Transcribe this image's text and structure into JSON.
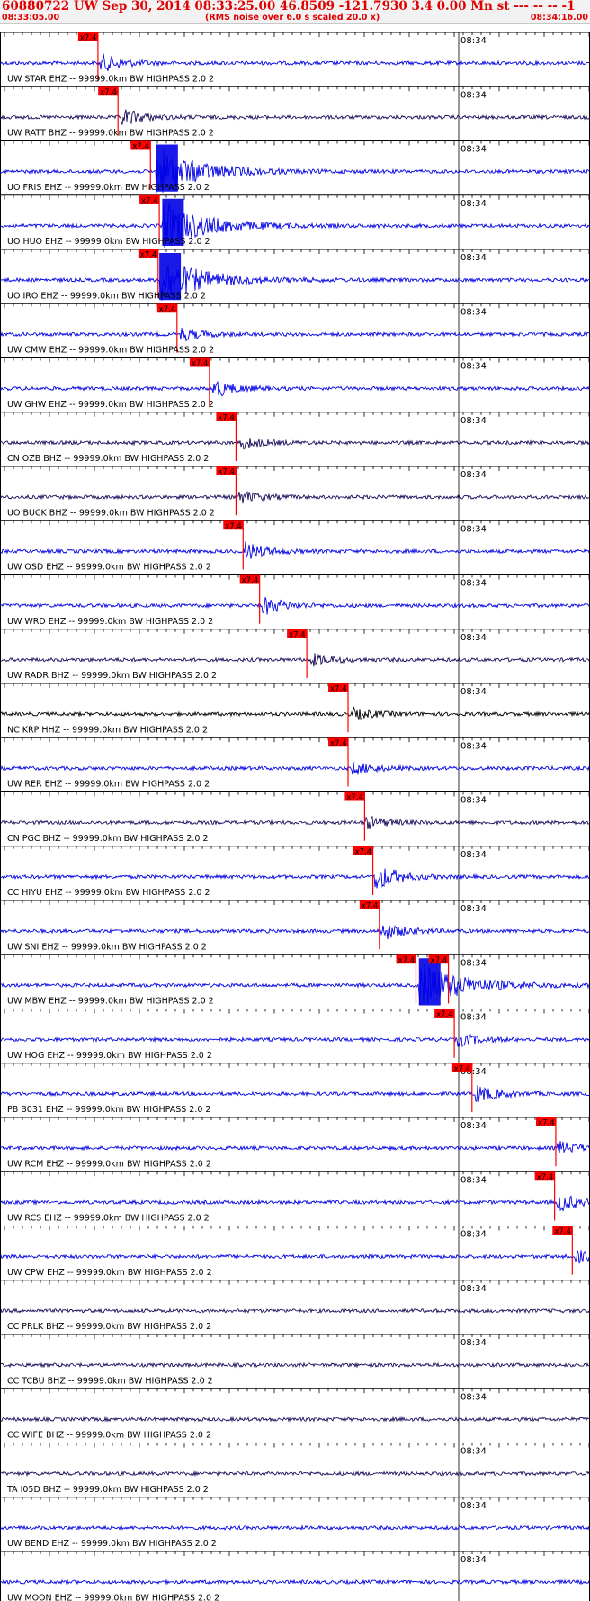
{
  "header": {
    "title": "60880722 UW Sep 30, 2014 08:33:25.00   46.8509 -121.7930  3.4 0.00 Mn st --- -- --   -1",
    "start_time": "08:33:05.00",
    "end_time": "08:34:16.00",
    "rms_note": "(RMS noise over 6.0 s scaled 20.0 x)"
  },
  "colors": {
    "trace_blue": "#0000e6",
    "trace_navy": "#1a0a5a",
    "trace_black": "#000000",
    "pick_red": "#ff0000",
    "axis": "#000000"
  },
  "chart_data": {
    "type": "seismogram",
    "time_start": "08:33:05.00",
    "time_end": "08:34:16.00",
    "minute_mark": "08:34",
    "pick_label": "x7.4",
    "traces": [
      {
        "label": "UW STAR EHZ -- 99999.0km BW  HIGHPASS  2.0  2",
        "color": "blue",
        "pick": 0.166,
        "onset": 0.17,
        "amp": "med"
      },
      {
        "label": "UW RATT BHZ -- 99999.0km BW  HIGHPASS  2.0  2",
        "color": "navy",
        "pick": 0.2,
        "onset": 0.205,
        "amp": "med"
      },
      {
        "label": "UO FRIS EHZ -- 99999.0km BW  HIGHPASS  2.0  2",
        "color": "blue",
        "pick": 0.255,
        "onset": 0.265,
        "amp": "clip"
      },
      {
        "label": "UO HUO EHZ -- 99999.0km BW  HIGHPASS  2.0  2",
        "color": "blue",
        "pick": 0.27,
        "onset": 0.275,
        "amp": "clip"
      },
      {
        "label": "UO IRO EHZ -- 99999.0km BW  HIGHPASS  2.0  2",
        "color": "blue",
        "pick": 0.268,
        "onset": 0.27,
        "amp": "clip"
      },
      {
        "label": "UW CMW EHZ -- 99999.0km BW  HIGHPASS  2.0  2",
        "color": "blue",
        "pick": 0.3,
        "onset": 0.305,
        "amp": "low"
      },
      {
        "label": "UW GHW EHZ -- 99999.0km BW  HIGHPASS  2.0  2",
        "color": "blue",
        "pick": 0.355,
        "onset": 0.36,
        "amp": "med"
      },
      {
        "label": "CN OZB BHZ -- 99999.0km BW  HIGHPASS  2.0  2",
        "color": "navy",
        "pick": 0.4,
        "onset": 0.405,
        "amp": "low"
      },
      {
        "label": "UO BUCK BHZ -- 99999.0km BW  HIGHPASS  2.0  2",
        "color": "navy",
        "pick": 0.4,
        "onset": 0.405,
        "amp": "low"
      },
      {
        "label": "UW OSD EHZ -- 99999.0km BW  HIGHPASS  2.0  2",
        "color": "blue",
        "pick": 0.412,
        "onset": 0.415,
        "amp": "med"
      },
      {
        "label": "UW WRD EHZ -- 99999.0km BW  HIGHPASS  2.0  2",
        "color": "blue",
        "pick": 0.44,
        "onset": 0.445,
        "amp": "med"
      },
      {
        "label": "UW RADR BHZ -- 99999.0km BW  HIGHPASS  2.0  2",
        "color": "navy",
        "pick": 0.52,
        "onset": 0.525,
        "amp": "low"
      },
      {
        "label": "NC KRP HHZ -- 99999.0km BW  HIGHPASS  2.0  2",
        "color": "black",
        "pick": 0.59,
        "onset": 0.595,
        "amp": "low"
      },
      {
        "label": "UW RER EHZ -- 99999.0km BW  HIGHPASS  2.0  2",
        "color": "blue",
        "pick": 0.59,
        "onset": 0.595,
        "amp": "low"
      },
      {
        "label": "CN PGC BHZ -- 99999.0km BW  HIGHPASS  2.0  2",
        "color": "navy",
        "pick": 0.618,
        "onset": 0.62,
        "amp": "low"
      },
      {
        "label": "CC HIYU EHZ -- 99999.0km BW  HIGHPASS  2.0  2",
        "color": "blue",
        "pick": 0.632,
        "onset": 0.635,
        "amp": "high"
      },
      {
        "label": "UW SNI EHZ -- 99999.0km BW  HIGHPASS  2.0  2",
        "color": "blue",
        "pick": 0.643,
        "onset": 0.645,
        "amp": "med"
      },
      {
        "label": "UW MBW EHZ -- 99999.0km BW  HIGHPASS  2.0  2",
        "color": "blue",
        "pick": 0.705,
        "onset": 0.71,
        "amp": "clip",
        "pick2": 0.76
      },
      {
        "label": "UW HOG EHZ -- 99999.0km BW  HIGHPASS  2.0  2",
        "color": "blue",
        "pick": 0.77,
        "onset": 0.775,
        "amp": "low"
      },
      {
        "label": "PB B031 EHZ -- 99999.0km BW  HIGHPASS  2.0  2",
        "color": "blue",
        "pick": 0.8,
        "onset": 0.805,
        "amp": "med"
      },
      {
        "label": "UW RCM EHZ -- 99999.0km BW  HIGHPASS  2.0  2",
        "color": "blue",
        "pick": 0.942,
        "onset": 0.945,
        "amp": "low"
      },
      {
        "label": "UW RCS EHZ -- 99999.0km BW  HIGHPASS  2.0  2",
        "color": "blue",
        "pick": 0.94,
        "onset": 0.945,
        "amp": "med"
      },
      {
        "label": "UW CPW EHZ -- 99999.0km BW  HIGHPASS  2.0  2",
        "color": "blue",
        "pick": 0.97,
        "onset": 0.975,
        "amp": "low"
      },
      {
        "label": "CC PRLK BHZ -- 99999.0km BW  HIGHPASS  2.0  2",
        "color": "navy",
        "amp": "low"
      },
      {
        "label": "CC TCBU BHZ -- 99999.0km BW  HIGHPASS  2.0  2",
        "color": "navy",
        "amp": "low"
      },
      {
        "label": "CC WIFE BHZ -- 99999.0km BW  HIGHPASS  2.0  2",
        "color": "navy",
        "amp": "low"
      },
      {
        "label": "TA I05D BHZ -- 99999.0km BW  HIGHPASS  2.0  2",
        "color": "navy",
        "amp": "low"
      },
      {
        "label": "UW BEND EHZ -- 99999.0km BW  HIGHPASS  2.0  2",
        "color": "blue",
        "amp": "low"
      },
      {
        "label": "UW MOON EHZ -- 99999.0km BW  HIGHPASS  2.0  2",
        "color": "blue",
        "amp": "low"
      }
    ]
  }
}
